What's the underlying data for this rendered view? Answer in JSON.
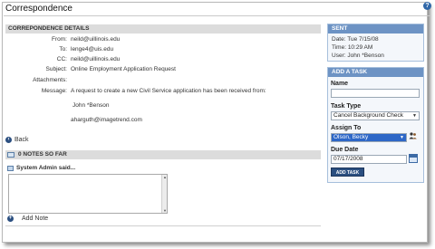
{
  "header": {
    "title": "Correspondence",
    "help_icon": "?"
  },
  "details": {
    "heading": "CORREPONDENCE DETAILS",
    "labels": {
      "from": "From:",
      "to": "To:",
      "cc": "CC:",
      "subject": "Subject:",
      "attachments": "Attachments:",
      "message": "Message:"
    },
    "from": "neild@uillinois.edu",
    "to": "lenge4@uis.edu",
    "cc": "neild@uillinois.edu",
    "subject": "Online Employment Application Request",
    "attachments": "",
    "message_line1": "A request to create a new Civil Service application has been received from:",
    "message_line2": "John *Benson",
    "message_line3": "aharguth@imagetrend.com"
  },
  "back": {
    "label": "Back"
  },
  "notes": {
    "heading": "0 NOTES SO FAR",
    "author_label": "System Admin said...",
    "add_note_label": "Add Note"
  },
  "sent": {
    "heading": "SENT",
    "date": "Date: Tue 7/15/08",
    "time": "Time: 10:29 AM",
    "user": "User: John *Benson"
  },
  "add_task": {
    "heading": "ADD A TASK",
    "name_label": "Name",
    "name_value": "",
    "task_type_label": "Task Type",
    "task_type_value": "Cancel Background Check",
    "assign_to_label": "Assign To",
    "assign_to_value": "Olson, Becky",
    "due_date_label": "Due Date",
    "due_date_value": "07/17/2008",
    "button_label": "ADD TASK"
  },
  "colors": {
    "accent": "#6d93c4",
    "button": "#2b4f80",
    "header_gray": "#dcdcdc"
  }
}
